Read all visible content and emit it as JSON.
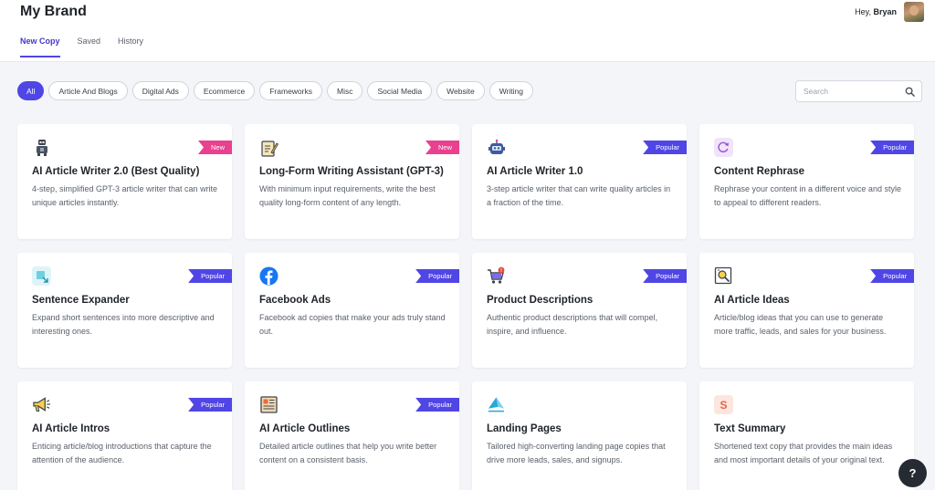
{
  "header": {
    "brand": "My Brand",
    "greeting": "Hey,",
    "user_name": "Bryan",
    "tabs": [
      {
        "label": "New Copy",
        "active": true
      },
      {
        "label": "Saved",
        "active": false
      },
      {
        "label": "History",
        "active": false
      }
    ]
  },
  "filters": [
    "All",
    "Article And Blogs",
    "Digital Ads",
    "Ecommerce",
    "Frameworks",
    "Misc",
    "Social Media",
    "Website",
    "Writing"
  ],
  "active_filter": "All",
  "search": {
    "placeholder": "Search"
  },
  "badges": {
    "popular": "Popular",
    "new": "New"
  },
  "colors": {
    "accent": "#4f46e5",
    "new_badge": "#e9408f",
    "help_button": "#252a33"
  },
  "cards": [
    {
      "title": "AI Article Writer 2.0 (Best Quality)",
      "description": "4-step, simplified GPT-3 article writer that can write unique articles instantly.",
      "badge": "New",
      "icon": "robot-icon"
    },
    {
      "title": "Long-Form Writing Assistant (GPT-3)",
      "description": "With minimum input requirements, write the best quality long-form content of any length.",
      "badge": "New",
      "icon": "notepad-pencil-icon"
    },
    {
      "title": "AI Article Writer 1.0",
      "description": "3-step article writer that can write quality articles in a fraction of the time.",
      "badge": "Popular",
      "icon": "robot-head-icon"
    },
    {
      "title": "Content Rephrase",
      "description": "Rephrase your content in a different voice and style to appeal to different readers.",
      "badge": "Popular",
      "icon": "refresh-icon"
    },
    {
      "title": "Sentence Expander",
      "description": "Expand short sentences into more descriptive and interesting ones.",
      "badge": "Popular",
      "icon": "expand-icon"
    },
    {
      "title": "Facebook Ads",
      "description": "Facebook ad copies that make your ads truly stand out.",
      "badge": "Popular",
      "icon": "facebook-icon"
    },
    {
      "title": "Product Descriptions",
      "description": "Authentic product descriptions that will compel, inspire, and influence.",
      "badge": "Popular",
      "icon": "shopping-cart-icon"
    },
    {
      "title": "AI Article Ideas",
      "description": "Article/blog ideas that you can use to generate more traffic, leads, and sales for your business.",
      "badge": "Popular",
      "icon": "idea-search-icon"
    },
    {
      "title": "AI Article Intros",
      "description": "Enticing article/blog introductions that capture the attention of the audience.",
      "badge": "Popular",
      "icon": "megaphone-icon"
    },
    {
      "title": "AI Article Outlines",
      "description": "Detailed article outlines that help you write better content on a consistent basis.",
      "badge": "Popular",
      "icon": "newspaper-icon"
    },
    {
      "title": "Landing Pages",
      "description": "Tailored high-converting landing page copies that drive more leads, sales, and signups.",
      "badge": "",
      "icon": "paper-plane-icon"
    },
    {
      "title": "Text Summary",
      "description": "Shortened text copy that provides the main ideas and most important details of your original text.",
      "badge": "",
      "icon": "summary-icon"
    }
  ],
  "help_button": "?"
}
